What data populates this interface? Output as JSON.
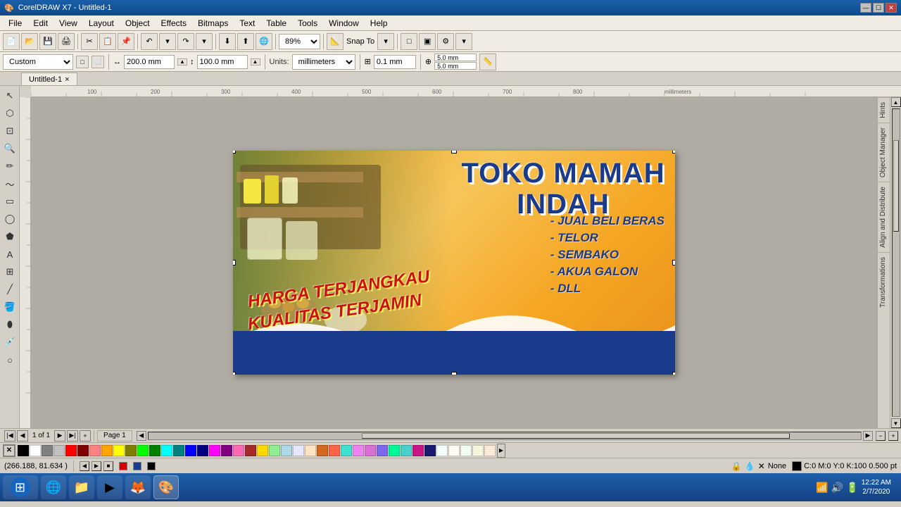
{
  "titlebar": {
    "icon": "🎨",
    "title": "CorelDRAW X7 - Untitled-1",
    "controls": [
      "—",
      "☐",
      "✕"
    ]
  },
  "menubar": {
    "items": [
      "File",
      "Edit",
      "View",
      "Layout",
      "Object",
      "Effects",
      "Bitmaps",
      "Text",
      "Table",
      "Tools",
      "Window",
      "Help"
    ]
  },
  "toolbar1": {
    "zoom": "89%",
    "snap_to": "Snap To"
  },
  "toolbar2": {
    "preset_label": "Custom",
    "width": "200.0 mm",
    "height": "100.0 mm",
    "units_label": "Units:",
    "units_value": "millimeters",
    "nudge_label": "0.1 mm",
    "nudge2": "5.0 mm",
    "nudge3": "5.0 mm"
  },
  "doctab": {
    "title": "Untitled-1",
    "close": "×"
  },
  "design": {
    "title": "TOKO MAMAH INDAH",
    "slogan1": "HARGA TERJANGKAU",
    "slogan2": "KUALITAS TERJAMIN",
    "items": [
      "- JUAL BELI BERAS",
      "- TELOR",
      "- SEMBAKO",
      "- AKUA GALON",
      "- DLL"
    ]
  },
  "statusbar": {
    "coordinates": "(266.188, 81.634 )",
    "fill_label": "None",
    "color_info": "C:0 M:0 Y:0 K:100 0.500 pt"
  },
  "page_controls": {
    "page_info": "1 of 1",
    "page_name": "Page 1"
  },
  "right_panel": {
    "tabs": [
      "Hints",
      "Object Manager",
      "Align and Distribute",
      "Transformations"
    ]
  },
  "taskbar": {
    "time": "12:22 AM",
    "date": "2/7/2020"
  },
  "colors": {
    "swatches": [
      "#000000",
      "#ffffff",
      "#808080",
      "#c0c0c0",
      "#ff0000",
      "#800000",
      "#ff8080",
      "#ffa500",
      "#ffff00",
      "#808000",
      "#00ff00",
      "#008000",
      "#00ffff",
      "#008080",
      "#0000ff",
      "#000080",
      "#ff00ff",
      "#800080",
      "#ff69b4",
      "#a52a2a",
      "#ffd700",
      "#90ee90",
      "#add8e6",
      "#e6e6fa",
      "#ffe4c4",
      "#d2691e",
      "#ff6347",
      "#40e0d0",
      "#ee82ee",
      "#da70d6",
      "#7b68ee",
      "#00fa9a",
      "#48d1cc",
      "#c71585",
      "#191970",
      "#f5fffa",
      "#fffaf0",
      "#f0fff0",
      "#f5f5dc",
      "#faebd7"
    ]
  }
}
